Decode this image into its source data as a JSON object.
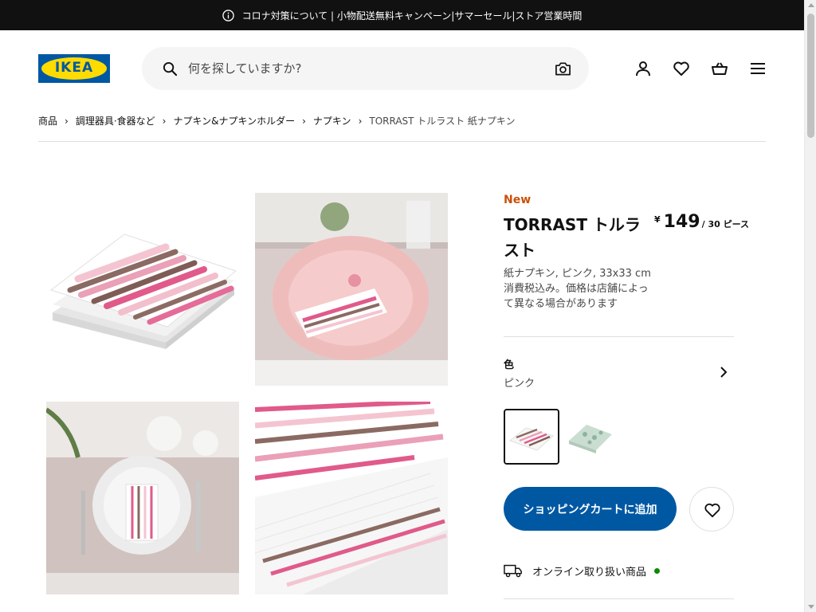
{
  "topbar": {
    "text": "コロナ対策について | 小物配送無料キャンペーン|サマーセール|ストア営業時間"
  },
  "logo": {
    "text": "IKEA"
  },
  "search": {
    "placeholder": "何を探していますか?"
  },
  "breadcrumb": {
    "items": [
      "商品",
      "調理器具·食器など",
      "ナプキン&ナプキンホルダー",
      "ナプキン",
      "TORRAST トルラスト 紙ナプキン"
    ],
    "separator": "›"
  },
  "product": {
    "badge": "New",
    "title": "TORRAST トルラスト",
    "price_currency": "¥",
    "price_amount": "149",
    "price_unit": "/ 30 ピース",
    "description_1": "紙ナプキン, ピンク, 33x33 cm",
    "description_2": "消費税込み。価格は店舗によって異なる場合があります"
  },
  "color": {
    "label": "色",
    "value": "ピンク"
  },
  "actions": {
    "add_to_cart": "ショッピングカートに追加"
  },
  "availability": {
    "online_label": "オンライン取り扱い商品",
    "status_color": "#0a8a00"
  },
  "colors": {
    "brand_blue": "#0058a3",
    "brand_yellow": "#ffdb00",
    "new_badge": "#ca5008"
  }
}
